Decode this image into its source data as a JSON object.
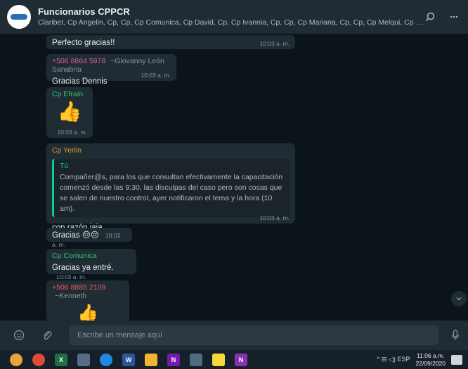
{
  "header": {
    "title": "Funcionarios CPPCR",
    "participants": "Claribet, Cp Angelin, Cp, Cp, Cp Comunica, Cp David, Cp, Cp Ivannia, Cp, Cp, Cp Mariana, Cp, Cp, Cp Melqui, Cp Miriam, Cp, Cp Olg...",
    "search_icon": "search-icon",
    "menu_icon": "more-vertical-icon"
  },
  "messages": [
    {
      "text": "Perfecto gracias!!",
      "time": "10:03 a. m."
    },
    {
      "sender": "+506 8864 5978",
      "sender_alias": "~Giovanny León Sanabria",
      "sender_color": "#d95e9a",
      "text": "Gracias Dennis",
      "time": "10:03 a. m."
    },
    {
      "sender": "Cp Efraín",
      "sender_color": "#35c46d",
      "sticker": "👍",
      "time": "10:03 a. m."
    },
    {
      "sender": "Cp Yerlin",
      "sender_color": "#e59a2c",
      "quote_author": "Tú",
      "quote_text": "Compañer@s, para los que consultan efectivamente la capacitación comenzó desde las 9:30, las disculpas del caso pero son cosas que se salen de nuestro control, ayer notificaron el tema y la hora (10 am).",
      "text": "con razón jaja",
      "time": "10:03 a. m."
    },
    {
      "text": "Gracias 😔😔",
      "time": "10:03 a. m."
    },
    {
      "sender": "Cp Comunica",
      "sender_color": "#35c46d",
      "text": "Gracias ya entré.",
      "time": "10:03 a. m."
    },
    {
      "sender": "+506 8885 2109",
      "sender_alias": "~Kenneth",
      "sender_color": "#e25c5c",
      "sticker": "👍"
    }
  ],
  "composer": {
    "placeholder": "Escribe un mensaje aquí",
    "emoji_icon": "emoji-icon",
    "attach_icon": "paperclip-icon",
    "mic_icon": "microphone-icon"
  },
  "taskbar": {
    "apps": [
      "start",
      "chrome",
      "excel",
      "app",
      "edge",
      "word",
      "files",
      "onenote",
      "calc",
      "sticky",
      "onenote2"
    ],
    "tray_text": "^ ⊟ ◁) ESP",
    "lang": "ESP",
    "time": "11:06 a.m.",
    "date": "22/09/2020"
  }
}
